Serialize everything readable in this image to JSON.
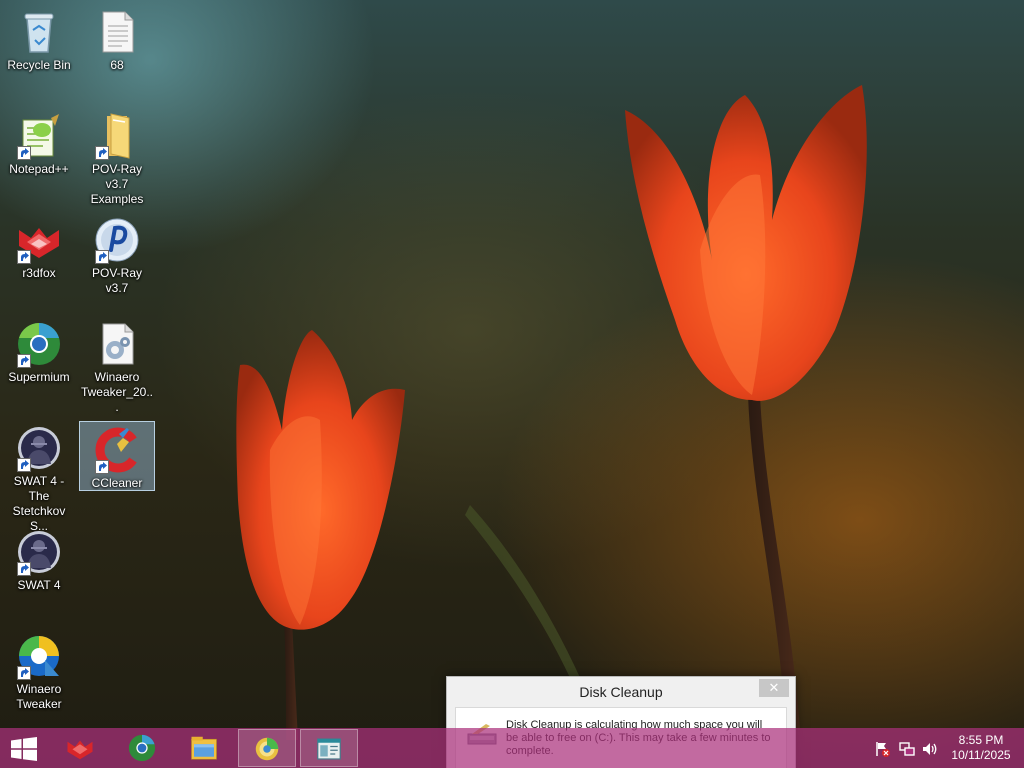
{
  "desktop": {
    "icons": [
      {
        "label": "Recycle Bin",
        "icon": "recycle-bin-icon"
      },
      {
        "label": "68",
        "icon": "text-file-icon"
      },
      {
        "label": "Notepad++",
        "icon": "notepad-plus-plus-icon"
      },
      {
        "label": "POV-Ray v3.7 Examples",
        "icon": "folder-icon"
      },
      {
        "label": "r3dfox",
        "icon": "r3dfox-icon"
      },
      {
        "label": "POV-Ray v3.7",
        "icon": "povray-icon"
      },
      {
        "label": "Supermium",
        "icon": "supermium-icon"
      },
      {
        "label": "Winaero Tweaker_20...",
        "icon": "settings-file-icon"
      },
      {
        "label": "SWAT 4 - The Stetchkov S...",
        "icon": "swat4-icon"
      },
      {
        "label": "CCleaner",
        "icon": "ccleaner-icon"
      },
      {
        "label": "SWAT 4",
        "icon": "swat4-icon"
      },
      {
        "label": "Winaero Tweaker",
        "icon": "winaero-tweaker-icon"
      }
    ]
  },
  "dialog": {
    "title": "Disk Cleanup",
    "close_label": "✕",
    "message": "Disk Cleanup is calculating how much space you will be able to free on  (C:). This may take a few minutes to complete."
  },
  "taskbar": {
    "buttons": [
      {
        "name": "start",
        "icon": "windows-logo-icon"
      },
      {
        "name": "r3dfox",
        "icon": "r3dfox-icon"
      },
      {
        "name": "supermium",
        "icon": "supermium-icon"
      },
      {
        "name": "file-explorer",
        "icon": "file-explorer-icon"
      },
      {
        "name": "disk-cleanup",
        "icon": "disk-cleanup-icon",
        "active": true
      },
      {
        "name": "window",
        "icon": "window-icon",
        "active": true
      }
    ],
    "tray": {
      "icons": [
        "action-center-flag-icon",
        "network-icon",
        "volume-icon"
      ],
      "time": "8:55 PM",
      "date": "10/11/2025"
    }
  },
  "colors": {
    "taskbar": "#aa307c",
    "selection": "#a0c8e6",
    "tulip": "#e8451c"
  }
}
